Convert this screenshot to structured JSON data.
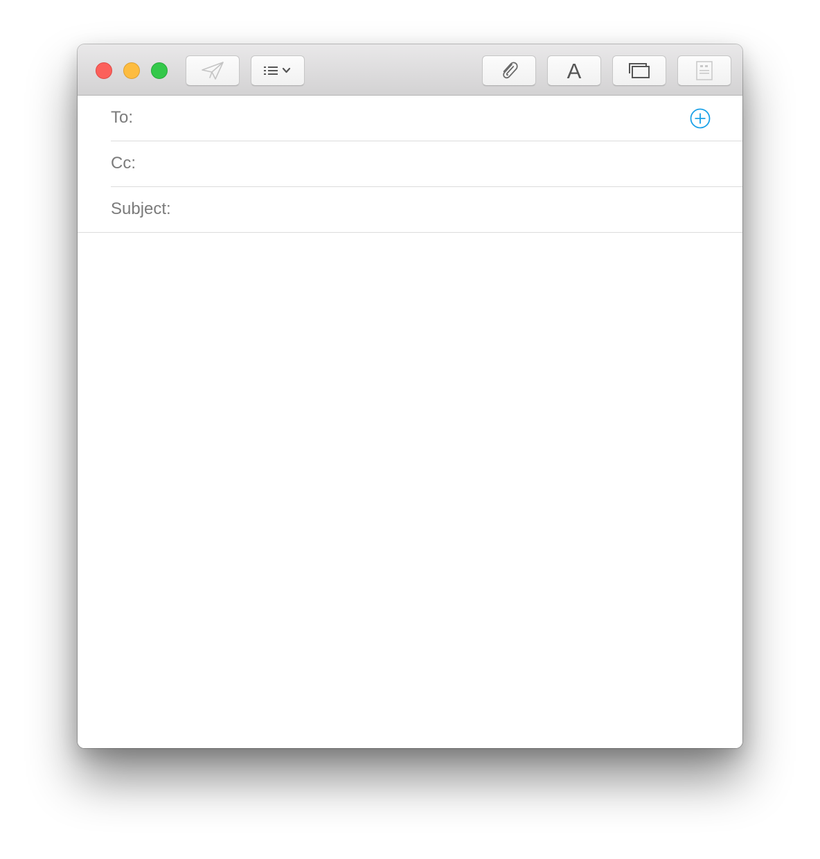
{
  "window": {
    "traffic_lights": [
      "close",
      "minimize",
      "zoom"
    ]
  },
  "toolbar": {
    "send_icon": "paper-plane-icon",
    "header_fields_icon": "list-with-chevron-icon",
    "attach_icon": "paperclip-icon",
    "fonts_label": "A",
    "browser_icon": "overlapping-windows-icon",
    "stationery_icon": "stationery-document-icon"
  },
  "headers": {
    "to_label": "To:",
    "to_value": "",
    "cc_label": "Cc:",
    "cc_value": "",
    "subject_label": "Subject:",
    "subject_value": "",
    "add_contact_icon": "plus-circle-icon"
  },
  "message": {
    "body": ""
  },
  "colors": {
    "close": "#fc605b",
    "minimize": "#fdbc40",
    "zoom": "#34c84a",
    "accent": "#1aa1e8",
    "label_gray": "#7b7b7b"
  }
}
